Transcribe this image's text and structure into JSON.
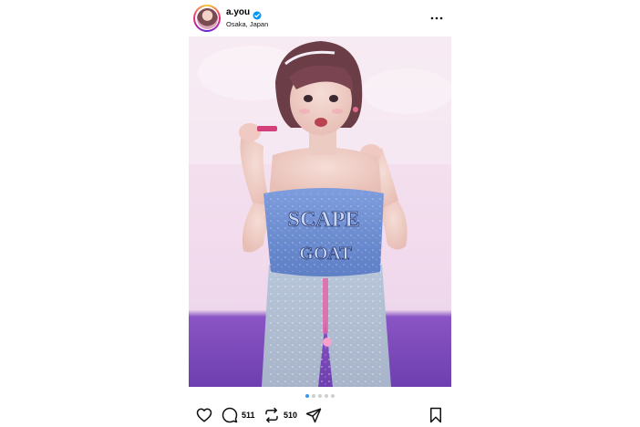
{
  "post": {
    "username": "a.you",
    "location": "Osaka, Japan",
    "verified": true,
    "photo_text": {
      "line1": "SCAPE",
      "line2": "GOAT"
    },
    "carousel": {
      "count": 5,
      "active_index": 0
    },
    "actions": {
      "comments_count": "511",
      "reposts_count": "510"
    },
    "icons": {
      "avatar": "avatar",
      "verified": "verified-badge-icon",
      "more": "more-options-icon",
      "like": "heart-icon",
      "comment": "comment-bubble-icon",
      "repost": "repost-icon",
      "share": "send-paper-plane-icon",
      "save": "bookmark-icon"
    },
    "colors": {
      "verified_badge": "#0095f6",
      "active_dot": "#3897f0",
      "stage_purple": "#7a47b8",
      "top_blue": "#6f93d4"
    }
  }
}
